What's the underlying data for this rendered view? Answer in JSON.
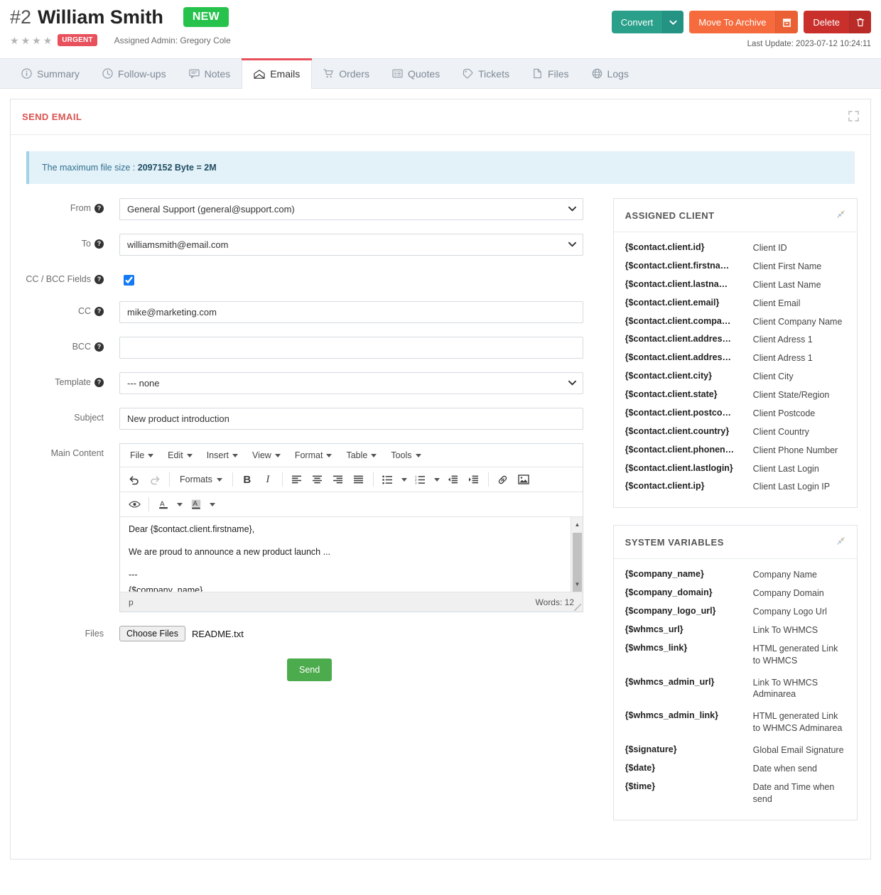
{
  "header": {
    "record_id": "#2",
    "record_name": "William Smith",
    "status_badge": "NEW",
    "stars": 4,
    "priority_badge": "URGENT",
    "assigned_admin": "Assigned Admin: Gregory Cole",
    "last_update": "Last Update: 2023-07-12 10:24:11",
    "actions": {
      "convert": "Convert",
      "convert_caret_icon": "chevron-down-icon",
      "archive": "Move To Archive",
      "archive_icon": "archive-icon",
      "delete": "Delete",
      "delete_icon": "trash-icon"
    }
  },
  "tabs": [
    {
      "label": "Summary",
      "icon": "info-circle-icon",
      "active": false
    },
    {
      "label": "Follow-ups",
      "icon": "clock-icon",
      "active": false
    },
    {
      "label": "Notes",
      "icon": "comment-icon",
      "active": false
    },
    {
      "label": "Emails",
      "icon": "envelope-open-icon",
      "active": true
    },
    {
      "label": "Orders",
      "icon": "cart-icon",
      "active": false
    },
    {
      "label": "Quotes",
      "icon": "list-alt-icon",
      "active": false
    },
    {
      "label": "Tickets",
      "icon": "ticket-icon",
      "active": false
    },
    {
      "label": "Files",
      "icon": "file-icon",
      "active": false
    },
    {
      "label": "Logs",
      "icon": "globe-icon",
      "active": false
    }
  ],
  "panel": {
    "title": "SEND EMAIL",
    "expand_icon": "expand-icon",
    "alert": "The maximum file size : 2097152 Byte = 2M",
    "alert_bold": "2097152 Byte = 2M",
    "alert_prefix": "The maximum file size : "
  },
  "form": {
    "from": {
      "label": "From",
      "value": "General Support (general@support.com)",
      "help_icon": "question-icon"
    },
    "to": {
      "label": "To",
      "value": "williamsmith@email.com",
      "help_icon": "question-icon"
    },
    "ccbcc": {
      "label": "CC / BCC Fields",
      "checked": true,
      "help_icon": "question-icon"
    },
    "cc": {
      "label": "CC",
      "value": "mike@marketing.com",
      "help_icon": "question-icon"
    },
    "bcc": {
      "label": "BCC",
      "value": "",
      "help_icon": "question-icon"
    },
    "template": {
      "label": "Template",
      "value": "--- none",
      "help_icon": "question-icon"
    },
    "subject": {
      "label": "Subject",
      "value": "New product introduction"
    },
    "main_content_label": "Main Content",
    "files": {
      "label": "Files",
      "button": "Choose Files",
      "filename": "README.txt"
    },
    "send_button": "Send"
  },
  "editor": {
    "menus": [
      "File",
      "Edit",
      "Insert",
      "View",
      "Format",
      "Table",
      "Tools"
    ],
    "formats_label": "Formats",
    "toolbar_icons": [
      "undo-icon",
      "redo-icon",
      "formats-dropdown",
      "bold-icon",
      "italic-icon",
      "align-left-icon",
      "align-center-icon",
      "align-right-icon",
      "align-justify-icon",
      "bullet-list-icon",
      "numbered-list-icon",
      "outdent-icon",
      "indent-icon",
      "link-icon",
      "image-icon",
      "preview-icon",
      "text-color-icon",
      "background-color-icon"
    ],
    "content_lines": [
      "Dear {$contact.client.firstname},",
      "",
      "We are proud to announce a new product launch ...",
      "---",
      "{$company_name}"
    ],
    "status_path": "p",
    "word_count": "Words: 12"
  },
  "assigned_client": {
    "title": "ASSIGNED CLIENT",
    "pin_icon": "pin-icon",
    "rows": [
      {
        "key": "{$contact.client.id}",
        "desc": "Client ID"
      },
      {
        "key": "{$contact.client.firstna…",
        "desc": "Client First Name"
      },
      {
        "key": "{$contact.client.lastna…",
        "desc": "Client Last Name"
      },
      {
        "key": "{$contact.client.email}",
        "desc": "Client Email"
      },
      {
        "key": "{$contact.client.compa…",
        "desc": "Client Company Name"
      },
      {
        "key": "{$contact.client.addres…",
        "desc": "Client Adress 1"
      },
      {
        "key": "{$contact.client.addres…",
        "desc": "Client Adress 1"
      },
      {
        "key": "{$contact.client.city}",
        "desc": "Client City"
      },
      {
        "key": "{$contact.client.state}",
        "desc": "Client State/Region"
      },
      {
        "key": "{$contact.client.postco…",
        "desc": "Client Postcode"
      },
      {
        "key": "{$contact.client.country}",
        "desc": "Client Country"
      },
      {
        "key": "{$contact.client.phonen…",
        "desc": "Client Phone Number"
      },
      {
        "key": "{$contact.client.lastlogin}",
        "desc": "Client Last Login"
      },
      {
        "key": "{$contact.client.ip}",
        "desc": "Client Last Login IP"
      }
    ]
  },
  "system_variables": {
    "title": "SYSTEM VARIABLES",
    "pin_icon": "pin-icon",
    "rows": [
      {
        "key": "{$company_name}",
        "desc": "Company Name"
      },
      {
        "key": "{$company_domain}",
        "desc": "Company Domain"
      },
      {
        "key": "{$company_logo_url}",
        "desc": "Company Logo Url"
      },
      {
        "key": "{$whmcs_url}",
        "desc": "Link To WHMCS"
      },
      {
        "key": "{$whmcs_link}",
        "desc": "HTML generated Link to WHMCS"
      },
      {
        "key": "{$whmcs_admin_url}",
        "desc": "Link To WHMCS Adminarea"
      },
      {
        "key": "{$whmcs_admin_link}",
        "desc": "HTML generated Link to WHMCS Adminarea"
      },
      {
        "key": "{$signature}",
        "desc": "Global Email Signature"
      },
      {
        "key": "{$date}",
        "desc": "Date when send"
      },
      {
        "key": "{$time}",
        "desc": "Date and Time when send"
      }
    ]
  },
  "colors": {
    "accent_red": "#d9534f",
    "green_new": "#27c24c",
    "urgent": "#e8505b",
    "convert": "#2aa08a",
    "archive": "#f56b3d",
    "delete": "#c9302c",
    "send": "#4cab4c",
    "info_bg": "#e3f1f8"
  }
}
